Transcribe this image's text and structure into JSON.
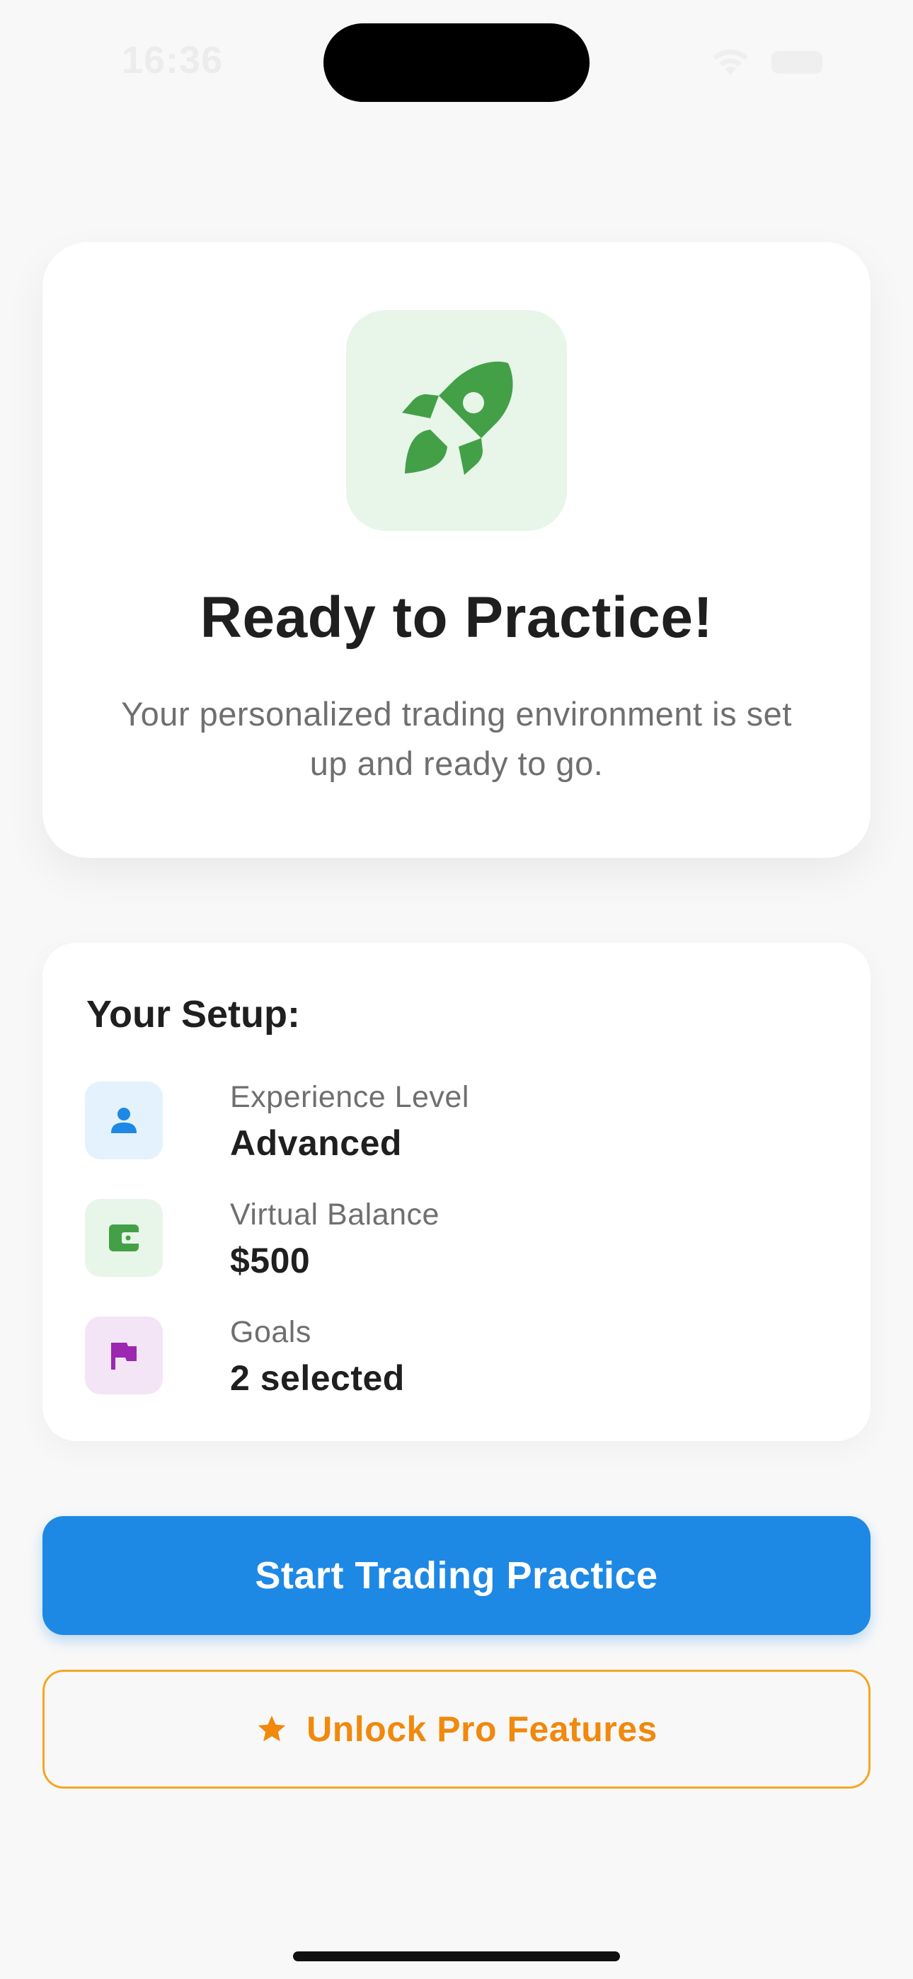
{
  "status_bar": {
    "time": "16:36"
  },
  "hero": {
    "icon": "rocket-icon",
    "title": "Ready to Practice!",
    "subtitle": "Your personalized trading environment is set up and ready to go."
  },
  "setup": {
    "title": "Your Setup:",
    "items": [
      {
        "icon": "person-icon",
        "label": "Experience Level",
        "value": "Advanced",
        "color": "#1e88e5",
        "bg": "#e3f2fd"
      },
      {
        "icon": "wallet-icon",
        "label": "Virtual Balance",
        "value": "$500",
        "color": "#43a047",
        "bg": "#e8f5e9"
      },
      {
        "icon": "flag-icon",
        "label": "Goals",
        "value": "2 selected",
        "color": "#9c27b0",
        "bg": "#f3e5f5"
      }
    ]
  },
  "actions": {
    "primary_label": "Start Trading Practice",
    "secondary_label": "Unlock Pro Features",
    "secondary_icon": "star-icon"
  },
  "colors": {
    "primary": "#1e88e5",
    "accent": "#f0890c",
    "success": "#43a047",
    "background": "#f8f8f8"
  }
}
